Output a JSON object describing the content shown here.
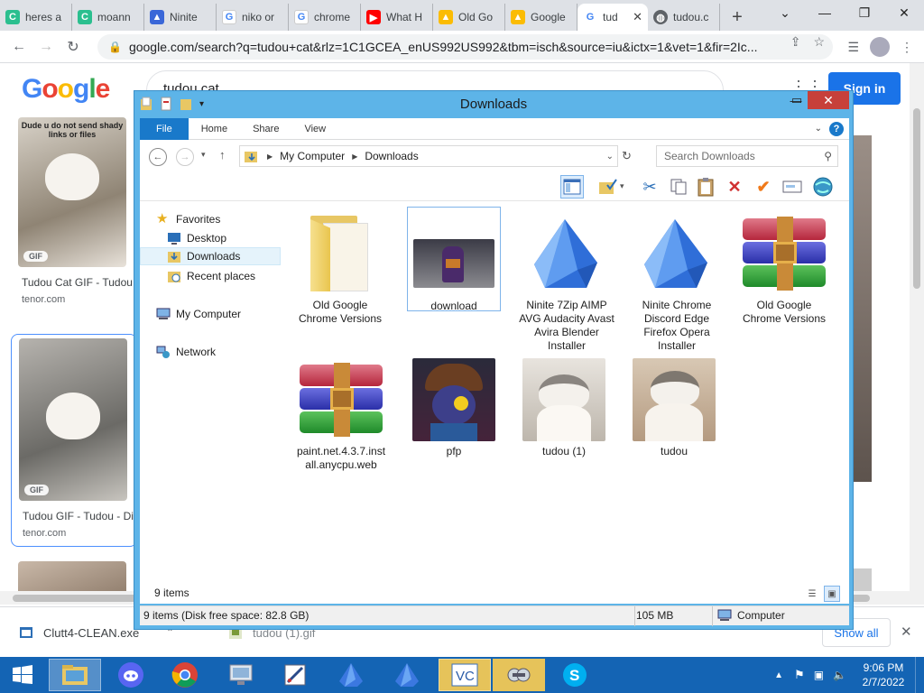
{
  "browser": {
    "tabs": [
      {
        "label": "heres a",
        "favicon_color": "#2bbf8f"
      },
      {
        "label": "moann",
        "favicon_color": "#2bbf8f"
      },
      {
        "label": "Ninite",
        "favicon_color": "#3a67d8"
      },
      {
        "label": "niko or",
        "favicon_color": "#4285f4"
      },
      {
        "label": "chrome",
        "favicon_color": "#4285f4"
      },
      {
        "label": "What H",
        "favicon_color": "#ff0000"
      },
      {
        "label": "Old Go",
        "favicon_color": "#fbbc04"
      },
      {
        "label": "Google",
        "favicon_color": "#fbbc04"
      },
      {
        "label": "tud",
        "favicon_color": "#4285f4"
      },
      {
        "label": "tudou.c",
        "favicon_color": "#5f6368"
      }
    ],
    "url": "google.com/search?q=tudou+cat&rlz=1C1GCEA_enUS992US992&tbm=isch&source=iu&ictx=1&vet=1&fir=2Ic...",
    "new_tab_symbol": "+"
  },
  "google": {
    "logo": "Google",
    "search_query": "tudou cat",
    "signin_label": "Sign in",
    "results": [
      {
        "title": "Tudou Cat GIF - Tudou ...",
        "source": "tenor.com",
        "badge": "GIF",
        "meme_text": "Dude u do not send shady links or files"
      },
      {
        "title": "Tudou GIF - Tudou - Dis...",
        "source": "tenor.com",
        "badge": "GIF"
      }
    ]
  },
  "downloads_bar": {
    "items": [
      {
        "name": "Clutt4-CLEAN.exe"
      },
      {
        "name": "tudou (1).gif"
      }
    ],
    "show_all": "Show all"
  },
  "taskbar": {
    "time": "9:06 PM",
    "date": "2/7/2022"
  },
  "explorer": {
    "title": "Downloads",
    "ribbon_tabs": [
      "File",
      "Home",
      "Share",
      "View"
    ],
    "breadcrumb": [
      "My Computer",
      "Downloads"
    ],
    "search_placeholder": "Search Downloads",
    "nav": {
      "favorites_label": "Favorites",
      "desktop": "Desktop",
      "downloads": "Downloads",
      "recent": "Recent places",
      "computer": "My Computer",
      "network": "Network"
    },
    "files": [
      {
        "name": "Old Google Chrome Versions",
        "type": "folder"
      },
      {
        "name": "download",
        "type": "image"
      },
      {
        "name": "Ninite 7Zip AIMP AVG Audacity Avast Avira Blender Installer",
        "type": "ninite"
      },
      {
        "name": "Ninite Chrome Discord Edge Firefox Opera Installer",
        "type": "ninite"
      },
      {
        "name": "Old Google Chrome Versions",
        "type": "rar"
      },
      {
        "name": "paint.net.4.3.7.install.anycpu.web",
        "type": "rar"
      },
      {
        "name": "pfp",
        "type": "image"
      },
      {
        "name": "tudou (1)",
        "type": "image"
      },
      {
        "name": "tudou",
        "type": "image"
      }
    ],
    "item_count": "9 items",
    "details_status": "9 items (Disk free space: 82.8 GB)",
    "size": "105 MB",
    "location": "Computer"
  }
}
